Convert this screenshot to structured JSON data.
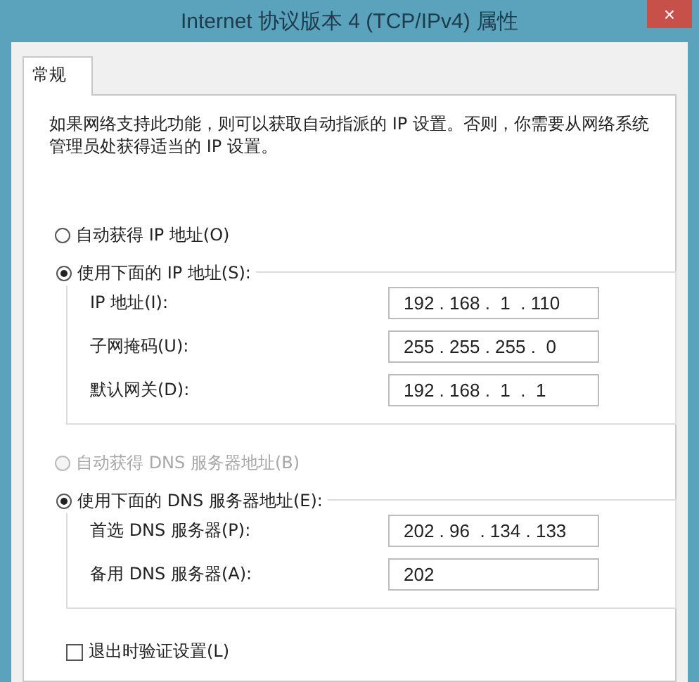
{
  "window": {
    "title": "Internet 协议版本 4 (TCP/IPv4) 属性",
    "close": "×"
  },
  "tabs": [
    {
      "label": "常规",
      "selected": true
    }
  ],
  "description": "如果网络支持此功能，则可以获取自动指派的 IP 设置。否则，你需要从网络系统管理员处获得适当的 IP 设置。",
  "ip_options": [
    {
      "label": "自动获得 IP 地址(O)",
      "selected": false,
      "disabled": false
    },
    {
      "label": "使用下面的 IP 地址(S):",
      "selected": true,
      "disabled": false
    }
  ],
  "ip_fields": [
    {
      "label": "IP 地址(I):",
      "value": "192 . 168 .  1  . 110"
    },
    {
      "label": "子网掩码(U):",
      "value": "255 . 255 . 255 .  0"
    },
    {
      "label": "默认网关(D):",
      "value": "192 . 168 .  1  .  1"
    }
  ],
  "dns_options": [
    {
      "label": "自动获得 DNS 服务器地址(B)",
      "selected": false,
      "disabled": true
    },
    {
      "label": "使用下面的 DNS 服务器地址(E):",
      "selected": true,
      "disabled": false
    }
  ],
  "dns_fields": [
    {
      "label": "首选 DNS 服务器(P):",
      "value": "202 . 96  . 134 . 133"
    },
    {
      "label": "备用 DNS 服务器(A):",
      "value": "202"
    }
  ],
  "validate": {
    "label": "退出时验证设置(L)",
    "checked": false
  }
}
